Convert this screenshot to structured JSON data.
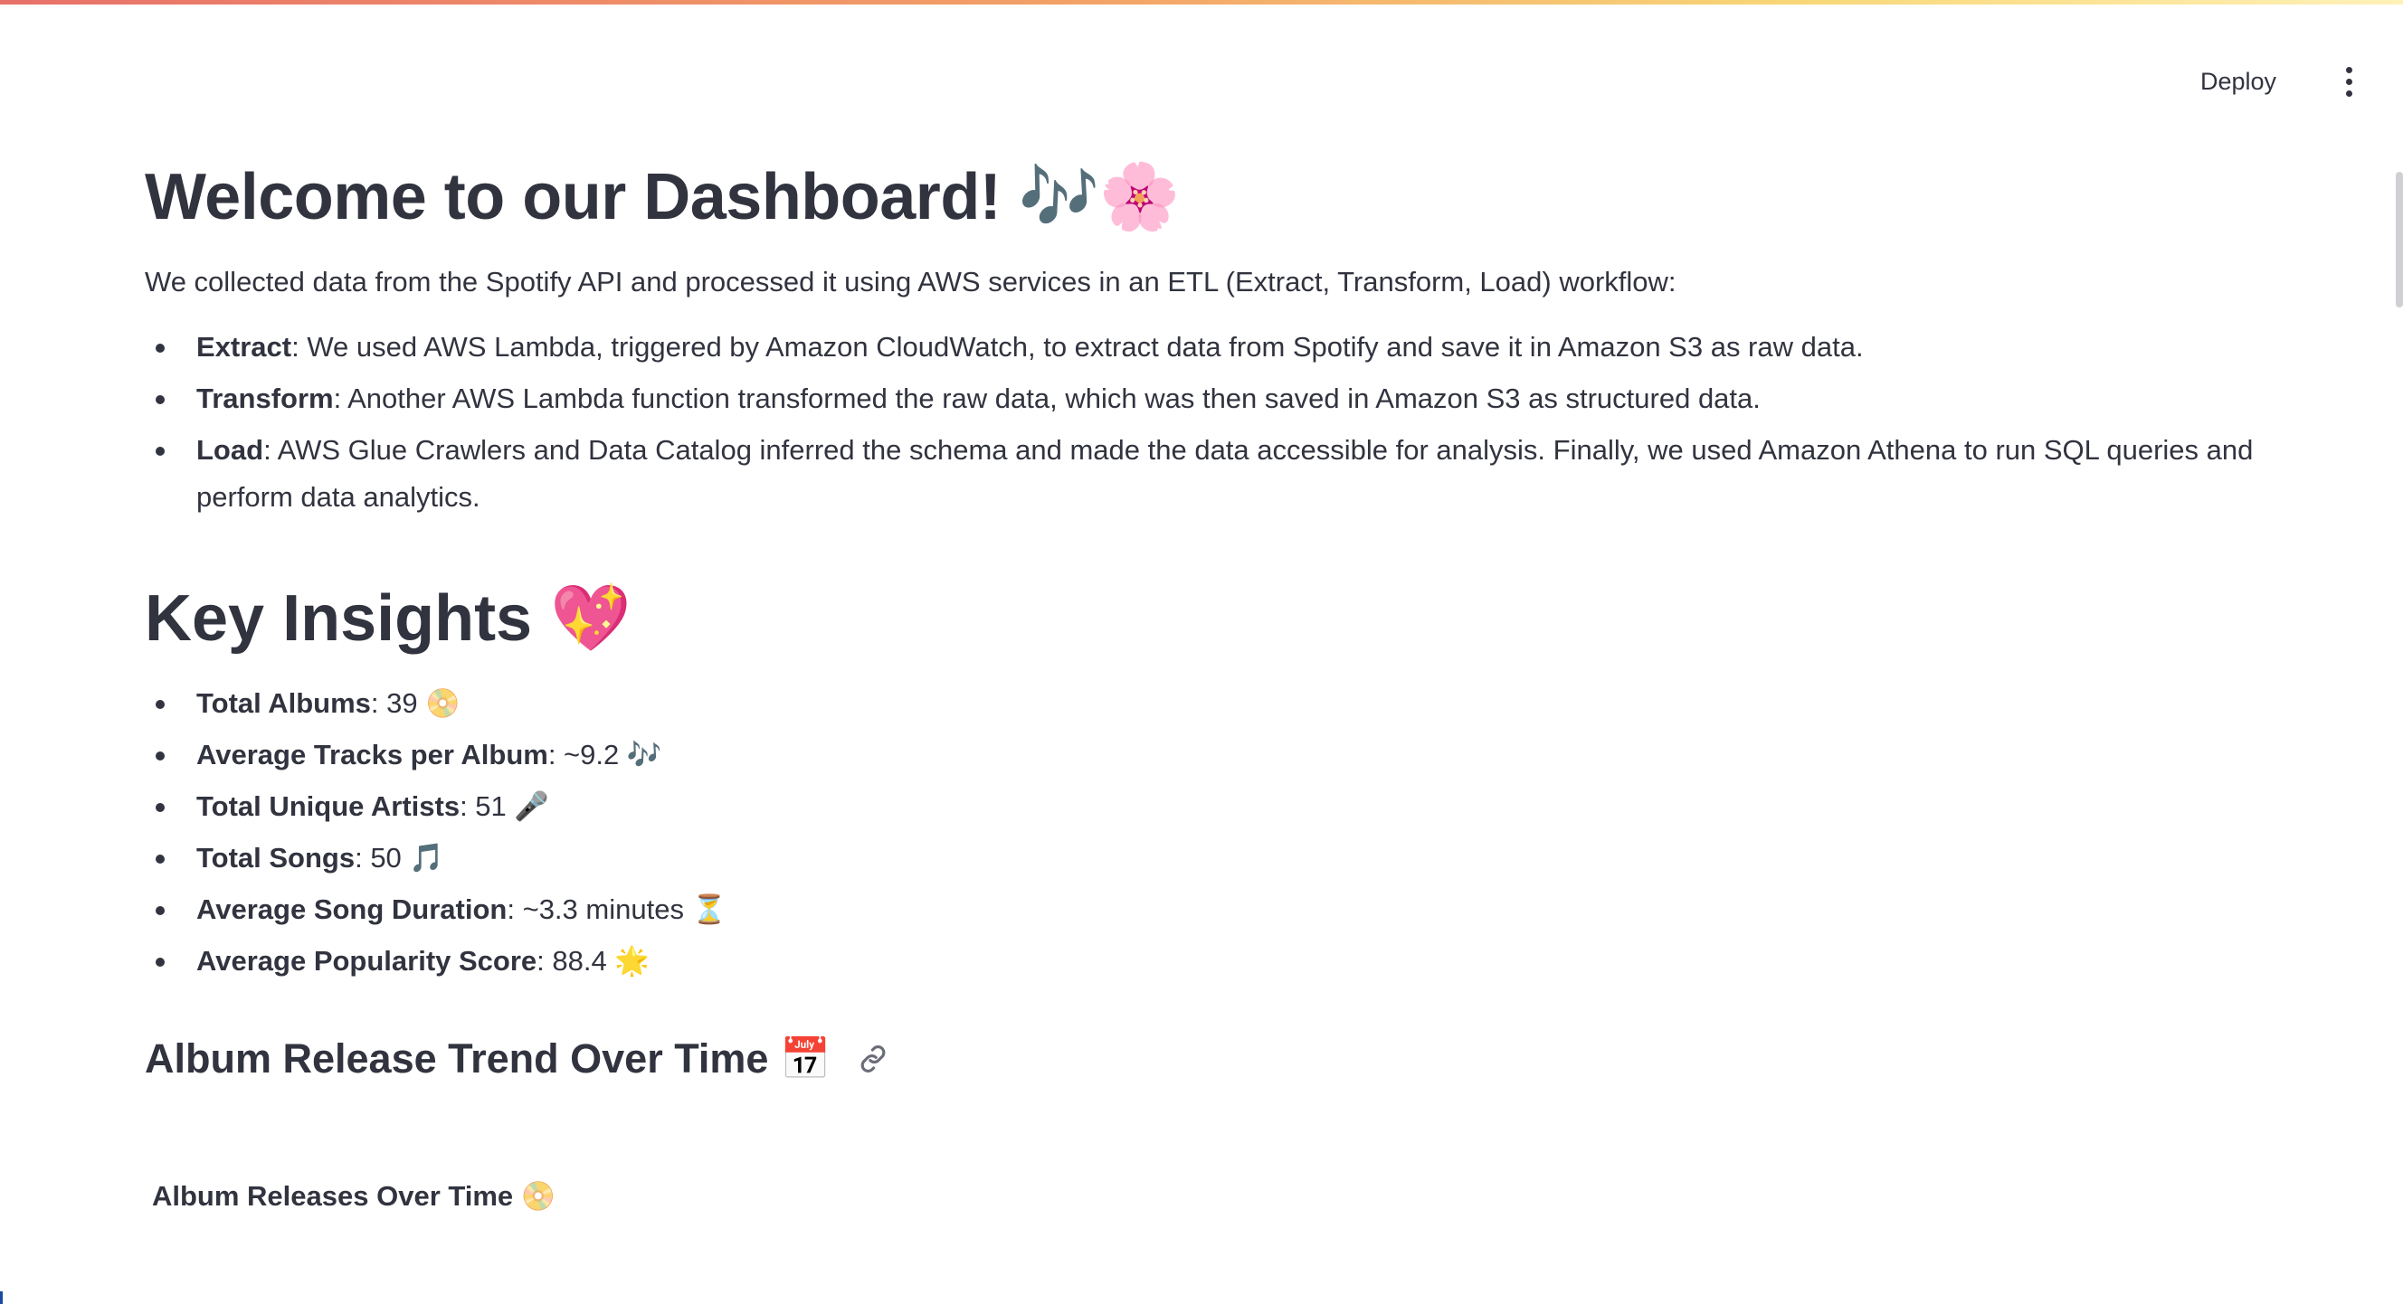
{
  "header": {
    "deploy_label": "Deploy"
  },
  "main": {
    "title": "Welcome to our Dashboard! 🎶🌸",
    "intro": "We collected data from the Spotify API and processed it using AWS services in an ETL (Extract, Transform, Load) workflow:",
    "pipeline": [
      {
        "term": "Extract",
        "text": ": We used AWS Lambda, triggered by Amazon CloudWatch, to extract data from Spotify and save it in Amazon S3 as raw data."
      },
      {
        "term": "Transform",
        "text": ": Another AWS Lambda function transformed the raw data, which was then saved in Amazon S3 as structured data."
      },
      {
        "term": "Load",
        "text": ": AWS Glue Crawlers and Data Catalog inferred the schema and made the data accessible for analysis. Finally, we used Amazon Athena to run SQL queries and perform data analytics."
      }
    ],
    "insights_title": "Key Insights 💖",
    "insights": [
      {
        "term": "Total Albums",
        "text": ": 39 📀"
      },
      {
        "term": "Average Tracks per Album",
        "text": ": ~9.2 🎶"
      },
      {
        "term": "Total Unique Artists",
        "text": ": 51 🎤"
      },
      {
        "term": "Total Songs",
        "text": ": 50 🎵"
      },
      {
        "term": "Average Song Duration",
        "text": ": ~3.3 minutes ⏳"
      },
      {
        "term": "Average Popularity Score",
        "text": ": 88.4 🌟"
      }
    ],
    "trend_title": "Album Release Trend Over Time 📅",
    "chart_title": "Album Releases Over Time 📀"
  },
  "icons": {
    "menu": "vertical-ellipsis-icon",
    "anchor": "link-icon"
  }
}
